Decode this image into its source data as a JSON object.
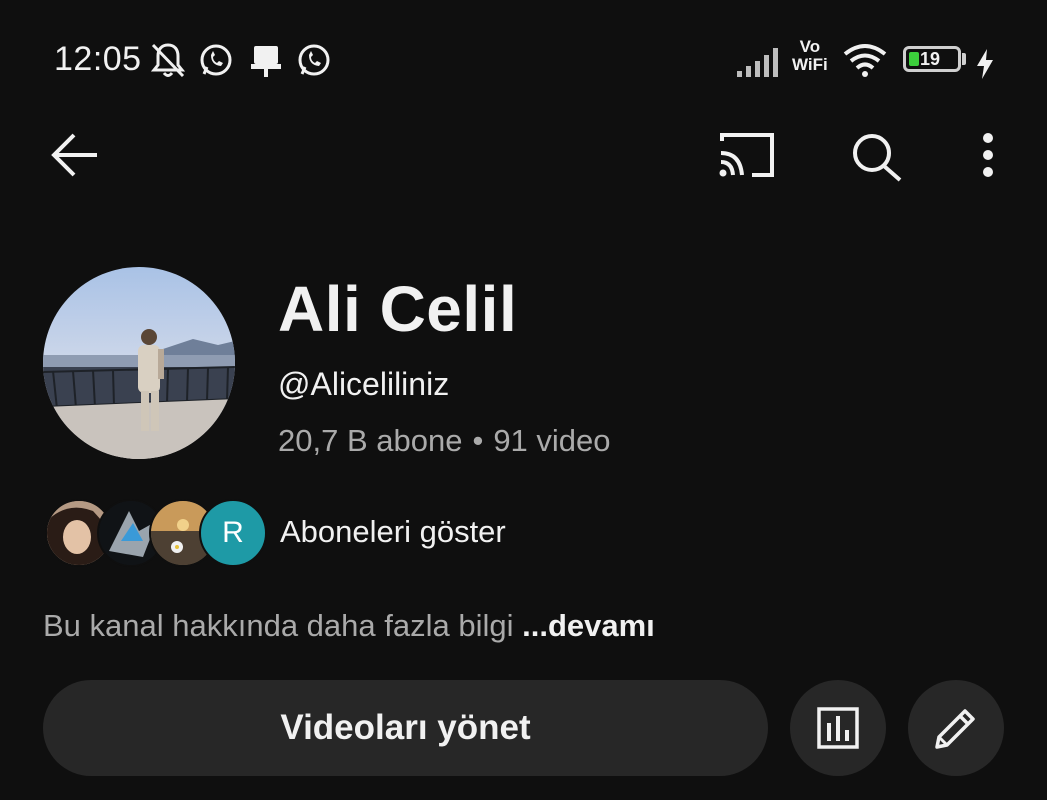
{
  "status_bar": {
    "time": "12:05",
    "network_label_top": "Vo",
    "network_label_bottom": "WiFi",
    "battery_level": "19",
    "icons": [
      "bell-off-icon",
      "whatsapp-icon",
      "notification-icon",
      "whatsapp-icon",
      "signal-icon",
      "wifi-icon",
      "battery-icon",
      "charging-icon"
    ]
  },
  "top_bar": {
    "icons": [
      "back-arrow-icon",
      "cast-icon",
      "search-icon",
      "more-vert-icon"
    ]
  },
  "channel": {
    "name": "Ali Celil",
    "handle": "@Aliceliliniz",
    "subscribers": "20,7 B abone",
    "separator": "•",
    "videos": "91 video",
    "subscriber_avatar_letter": "R",
    "show_subscribers_label": "Aboneleri göster",
    "description": "Bu kanal hakkında daha fazla bilgi",
    "more_label": "...devamı"
  },
  "actions": {
    "manage_videos_label": "Videoları yönet",
    "icons": [
      "analytics-icon",
      "edit-pencil-icon"
    ]
  },
  "colors": {
    "background": "#0f0f0f",
    "button_bg": "#272727",
    "secondary_text": "#aaaaaa",
    "primary_text": "#f1f1f1",
    "battery_green": "#3ccf3c",
    "avatar_r_bg": "#1e9aa6"
  }
}
